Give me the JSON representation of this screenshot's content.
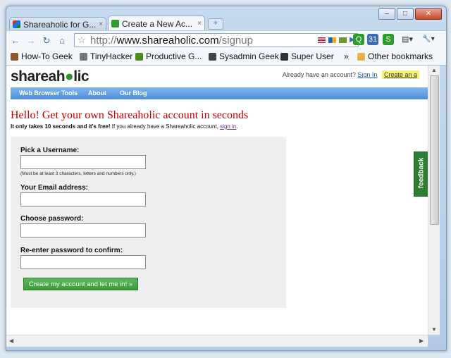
{
  "window": {
    "minimize": "–",
    "maximize": "□",
    "close": "✕"
  },
  "tabs": [
    {
      "title": "Shareaholic for G...",
      "close": "×",
      "favicon_color": "#2a7bd8"
    },
    {
      "title": "Create a New Ac...",
      "close": "×",
      "favicon_color": "#2a9d2a"
    }
  ],
  "new_tab_glyph": "+",
  "toolbar": {
    "back": "←",
    "forward": "→",
    "reload": "↻",
    "home": "⌂",
    "star": "☆",
    "url_prefix": "http://",
    "url_host": "www.shareaholic.com",
    "url_path": "/signup",
    "page_menu": "▤▾",
    "tools_menu": "🔧▾"
  },
  "bookmarks": [
    {
      "label": "How-To Geek",
      "icon_color": "#8b5a2b"
    },
    {
      "label": "TinyHacker",
      "icon_color": "#777777"
    },
    {
      "label": "Productive G...",
      "icon_color": "#4a8a1e"
    },
    {
      "label": "Sysadmin Geek",
      "icon_color": "#444444"
    },
    {
      "label": "Super User",
      "icon_color": "#333333"
    }
  ],
  "bookmarks_more": "»",
  "other_bookmarks": "Other bookmarks",
  "site": {
    "logo_prefix": "shareah",
    "logo_eye": "●",
    "logo_suffix": "lic",
    "already_text": "Already have an account?",
    "signin_link": "Sign In",
    "create_link": "Create an a",
    "nav": [
      "Web Browser Tools",
      "About",
      "Our Blog"
    ],
    "heading": "Hello! Get your own Shareaholic account in seconds",
    "sub_bold": "It only takes 10 seconds and it's free!",
    "sub_text": " If you already have a Shareaholic account, ",
    "sub_link": "sign in",
    "sub_end": ".",
    "form": {
      "username_label": "Pick a Username:",
      "username_hint": "(Must be at least 3 characters, letters and numbers only.)",
      "email_label": "Your Email address:",
      "password_label": "Choose password:",
      "confirm_label": "Re-enter password to confirm:",
      "submit": "Create my account and let me in! »"
    },
    "feedback": "feedback"
  }
}
